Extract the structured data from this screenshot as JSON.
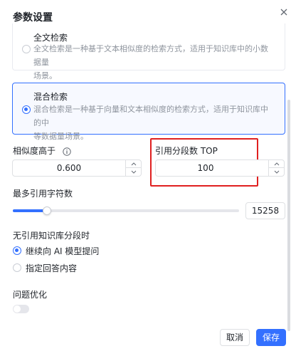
{
  "dialog": {
    "title": "参数设置",
    "close_icon": "close-icon"
  },
  "search_modes": [
    {
      "title": "全文检索",
      "description_line1": "全文检索是一种基于文本相似度的检索方式，适用于知识库中的小数据量",
      "description_line2": "场景。",
      "selected": false
    },
    {
      "title": "混合检索",
      "description_line1": "混合检索是一种基于向量和文本相似度的检索方式，适用于知识库中的中",
      "description_line2": "等数据量场景。",
      "selected": true
    }
  ],
  "similarity": {
    "label": "相似度高于",
    "info_icon": "info-icon",
    "value": "0.600"
  },
  "top_segments": {
    "label": "引用分段数 TOP",
    "value": "100"
  },
  "max_chars": {
    "label": "最多引用字符数",
    "value": "15258",
    "slider_fraction": 0.15
  },
  "no_reference": {
    "label": "无引用知识库分段时",
    "options": [
      {
        "label": "继续向 AI 模型提问",
        "selected": true
      },
      {
        "label": "指定回答内容",
        "selected": false
      }
    ]
  },
  "question_optimization": {
    "label": "问题优化",
    "enabled": false
  },
  "footer": {
    "cancel_label": "取消",
    "save_label": "保存"
  },
  "colors": {
    "accent": "#3370ff",
    "highlight_border": "#e02020"
  }
}
